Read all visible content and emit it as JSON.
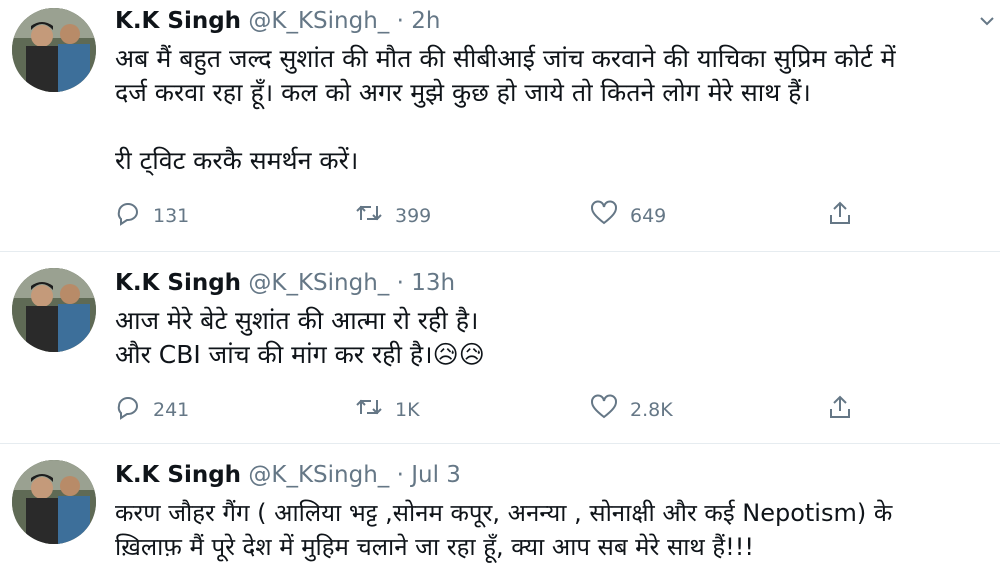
{
  "tweets": [
    {
      "name": "K.K Singh",
      "handle": "@K_KSingh_",
      "time": "2h",
      "text": "अब मैं बहुत जल्द सुशांत की मौत की सीबीआई जांच करवाने की याचिका सुप्रिम कोर्ट में\nदर्ज करवा रहा हूँ। कल को अगर मुझे कुछ हो जाये तो कितने लोग मेरे साथ हैं।\n\nरी ट्विट करकै समर्थन करें।",
      "replies": "131",
      "retweets": "399",
      "likes": "649"
    },
    {
      "name": "K.K Singh",
      "handle": "@K_KSingh_",
      "time": "13h",
      "text": "आज मेरे बेटे सुशांत की आत्मा रो रही है।\nऔर CBI जांच की मांग कर रही है।😥😥",
      "replies": "241",
      "retweets": "1K",
      "likes": "2.8K"
    },
    {
      "name": "K.K Singh",
      "handle": "@K_KSingh_",
      "time": "Jul 3",
      "text": "करण जौहर गैंग ( आलिया भट्ट ,सोनम कपूर, अनन्या , सोनाक्षी  और कई Nepotism) के\nख़िलाफ़ मैं पूरे देश में मुहिम चलाने जा रहा हूँ, क्या आप सब मेरे साथ हैं!!!"
    }
  ],
  "separator": "·",
  "colors": {
    "text": "#0f1419",
    "secondary": "#657786",
    "divider": "#e6ecf0"
  }
}
